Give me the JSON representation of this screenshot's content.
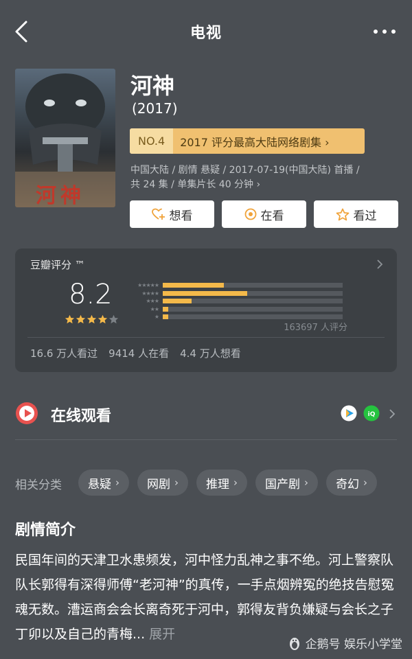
{
  "nav": {
    "title": "电视"
  },
  "movie": {
    "poster_title": "河神",
    "title": "河神",
    "year": "(2017)",
    "rank_no": "NO.4",
    "rank_text": "2017 评分最高大陆网络剧集",
    "meta_line1": "中国大陆 / 剧情 悬疑 / 2017-07-19(中国大陆) 首播 /",
    "meta_line2": "共 24 集 / 单集片长 40 分钟 "
  },
  "actions": {
    "want": "想看",
    "watching": "在看",
    "watched": "看过"
  },
  "rating": {
    "label": "豆瓣评分 ™",
    "score": "8.2",
    "stars_filled": 4,
    "distribution": [
      0.34,
      0.47,
      0.16,
      0.03,
      0.03
    ],
    "count_text": "163697 人评分",
    "watched": "16.6 万人看过",
    "watching": "9414 人在看",
    "want": "4.4 万人想看"
  },
  "online": {
    "label": "在线观看"
  },
  "tags": {
    "label": "相关分类",
    "items": [
      {
        "label": "悬疑"
      },
      {
        "label": "网剧"
      },
      {
        "label": "推理"
      },
      {
        "label": "国产剧"
      },
      {
        "label": "奇幻"
      }
    ]
  },
  "synopsis": {
    "title": "剧情简介",
    "text": "民国年间的天津卫水患频发，河中怪力乱神之事不绝。河上警察队队长郭得有深得师傅“老河神”的真传，一手点烟辨冤的绝技告慰冤魂无数。漕运商会会长离奇死于河中，郭得友背负嫌疑与会长之子丁卯以及自己的青梅...",
    "expand": " 展开"
  },
  "watermark": {
    "text": "企鹅号 娱乐小学堂"
  },
  "colors": {
    "background": "#4a4e53",
    "card": "#3c4044",
    "accent": "#f4b94a",
    "rank_banner": "#f0c070"
  }
}
